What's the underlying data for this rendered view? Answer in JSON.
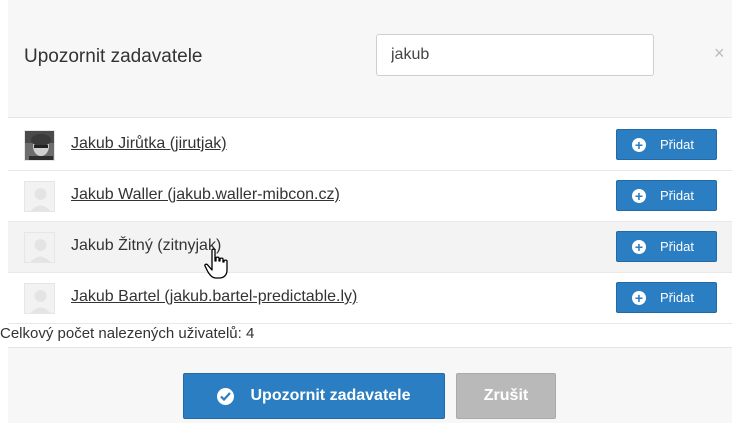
{
  "dialog": {
    "title": "Upozornit zadavatele",
    "search_value": "jakub",
    "search_placeholder": "",
    "close_symbol": "×"
  },
  "users": [
    {
      "name": "Jakub Jirůtka (jirutjak)",
      "avatar": "photo",
      "add_label": "Přidat"
    },
    {
      "name": "Jakub Waller (jakub.waller-mibcon.cz)",
      "avatar": "placeholder",
      "add_label": "Přidat"
    },
    {
      "name": "Jakub Žitný (zitnyjak)",
      "avatar": "placeholder",
      "add_label": "Přidat"
    },
    {
      "name": "Jakub Bartel (jakub.bartel-predictable.ly)",
      "avatar": "placeholder",
      "add_label": "Přidat"
    }
  ],
  "summary": {
    "count_text": "Celkový počet nalezených uživatelů: 4"
  },
  "footer": {
    "confirm_label": "Upozornit zadavatele",
    "cancel_label": "Zrušit"
  },
  "colors": {
    "primary": "#2a7ec1",
    "disabled": "#b9b9b9",
    "header_bg": "#f7f7f7"
  },
  "icons": {
    "add": "plus-circle-icon",
    "confirm": "check-circle-icon",
    "close": "close-icon",
    "cursor": "hand-pointer-icon"
  }
}
